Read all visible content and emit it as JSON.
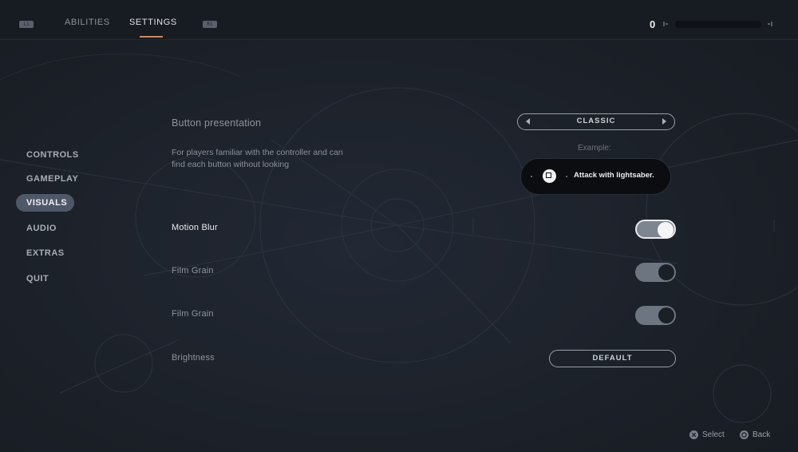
{
  "top_bar": {
    "left_bumper": "L1",
    "right_bumper": "R1",
    "tabs": [
      {
        "label": "ABILITIES"
      },
      {
        "label": "SETTINGS",
        "active": true
      }
    ],
    "skill_points": "0",
    "xp_progress": 0
  },
  "sidebar": {
    "items": [
      {
        "label": "CONTROLS"
      },
      {
        "label": "GAMEPLAY"
      },
      {
        "label": "VISUALS",
        "active": true
      },
      {
        "label": "AUDIO"
      },
      {
        "label": "EXTRAS"
      },
      {
        "label": "QUIT"
      }
    ]
  },
  "settings": {
    "button_presentation": {
      "label": "Button presentation",
      "description": "For players familiar with the controller and can find each button without looking",
      "value": "CLASSIC",
      "example_label": "Example:",
      "example_text": "Attack with lightsaber."
    },
    "motion_blur": {
      "label": "Motion Blur",
      "enabled": true
    },
    "film_grain_1": {
      "label": "Film Grain",
      "enabled": true
    },
    "film_grain_2": {
      "label": "Film Grain",
      "enabled": true
    },
    "brightness": {
      "label": "Brightness",
      "button": "DEFAULT"
    }
  },
  "hints": {
    "select": "Select",
    "back": "Back"
  },
  "colors": {
    "accent": "#c98a62",
    "active_pill": "#4f5869",
    "background": "#1b2029"
  }
}
